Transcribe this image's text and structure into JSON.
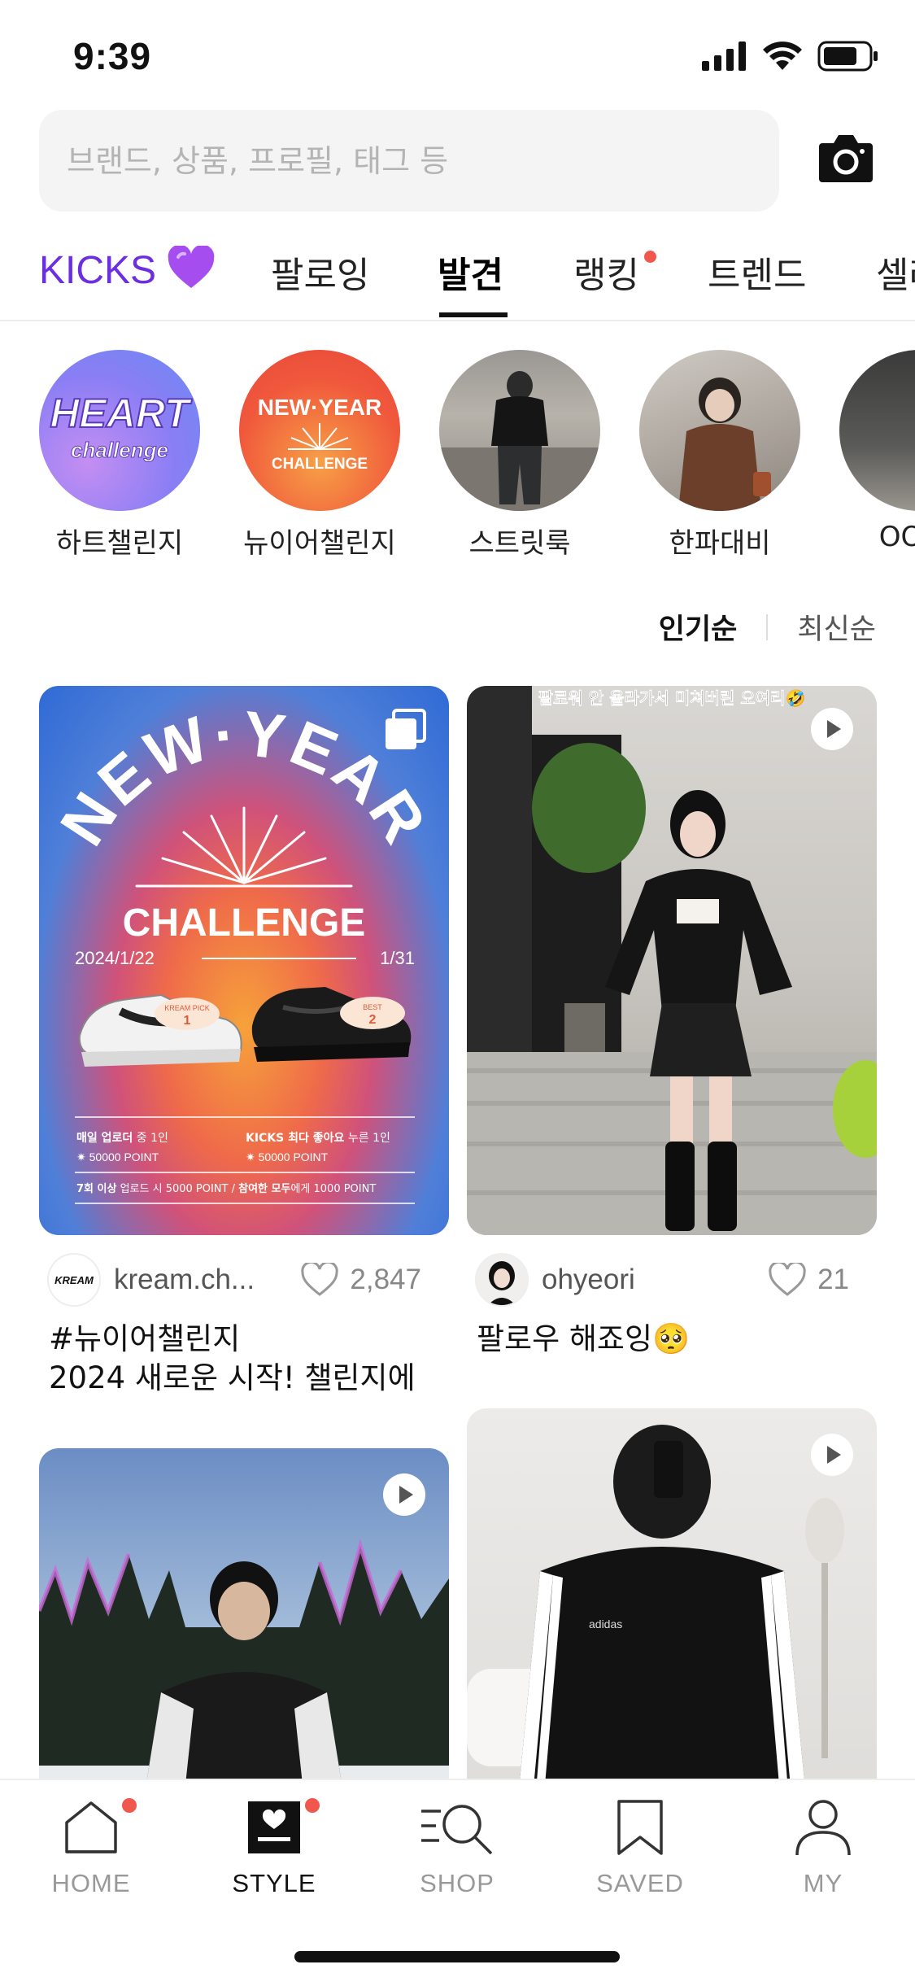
{
  "status_bar": {
    "time": "9:39"
  },
  "search": {
    "placeholder": "브랜드, 상품, 프로필, 태그 등"
  },
  "tabs": [
    {
      "label": "KICKS",
      "emoji": "💜"
    },
    {
      "label": "팔로잉"
    },
    {
      "label": "발견",
      "active": true
    },
    {
      "label": "랭킹",
      "dot": true
    },
    {
      "label": "트렌드"
    },
    {
      "label": "셀러"
    }
  ],
  "stories": [
    {
      "label": "하트챌린지",
      "art_text": "HEART",
      "art_sub": "challenge"
    },
    {
      "label": "뉴이어챌린지",
      "art_text": "NEW·YEAR",
      "art_sub": "CHALLENGE"
    },
    {
      "label": "스트릿룩"
    },
    {
      "label": "한파대비"
    },
    {
      "label": "OOTD"
    }
  ],
  "sort": {
    "popular": "인기순",
    "latest": "최신순"
  },
  "feed": [
    {
      "user": "kream.ch...",
      "avatar_text": "KREAM",
      "likes": "2,847",
      "caption_line1": "#뉴이어챌린지",
      "caption_line2": "2024 새로운 시작! 챌린지에",
      "poster": {
        "title_top": "NEW·YEAR",
        "title_main": "CHALLENGE",
        "date_start": "2024/1/22",
        "date_end": "1/31",
        "pick_label": "KREAM PICK",
        "pick_num": "1",
        "best_label": "BEST",
        "best_num": "2",
        "rule1_a": "매일 업로더",
        "rule1_b": " 중 1인",
        "rule1_point": "✷ 50000 POINT",
        "rule2_a": "KICKS 최다 좋아요",
        "rule2_b": " 누른 1인",
        "rule2_point": "✷ 50000 POINT",
        "rule3_a": "7회 이상",
        "rule3_b": " 업로드 시 5000 POINT / ",
        "rule3_c": "참여한 모두",
        "rule3_d": "에게 1000 POINT"
      }
    },
    {
      "user": "ohyeori",
      "likes": "21",
      "caption": "팔로우 해죠잉🥺",
      "overlay_text": "팔로워 안 올라가서 미쳐버린 오여리🤣"
    }
  ],
  "bottom_nav": [
    {
      "label": "HOME",
      "icon": "home-icon",
      "dot": true
    },
    {
      "label": "STYLE",
      "icon": "style-icon",
      "dot": true,
      "active": true
    },
    {
      "label": "SHOP",
      "icon": "shop-search-icon"
    },
    {
      "label": "SAVED",
      "icon": "bookmark-icon"
    },
    {
      "label": "MY",
      "icon": "person-icon"
    }
  ],
  "colors": {
    "accent": "#6b2ee0",
    "dot": "#f0584e"
  }
}
